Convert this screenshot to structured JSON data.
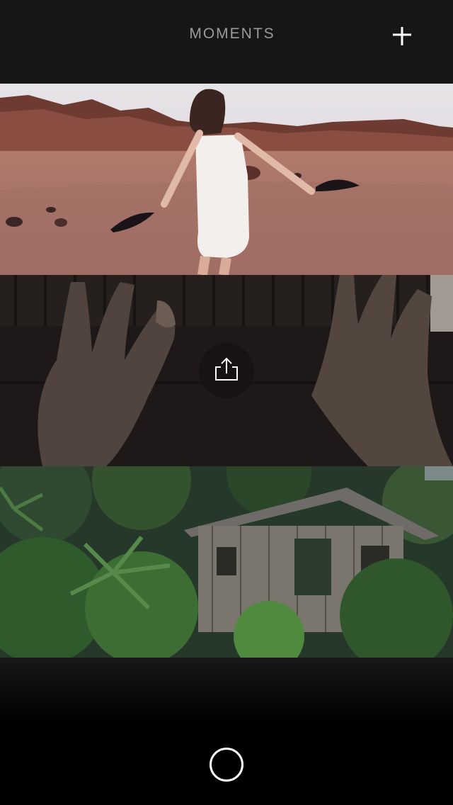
{
  "header": {
    "title": "MOMENTS",
    "add_icon": "plus-icon"
  },
  "moments": [
    {
      "subject": "woman-dancing-in-desert-with-feathers"
    },
    {
      "subject": "hands-playing-piano",
      "action_icon": "share-icon"
    },
    {
      "subject": "abandoned-wooden-house-in-jungle"
    }
  ],
  "footer": {
    "record_icon": "circle-record-icon"
  },
  "colors": {
    "header_bg": "#161616",
    "title_text": "#9a9a9a",
    "icon": "#ffffff",
    "page_bg": "#000000"
  }
}
